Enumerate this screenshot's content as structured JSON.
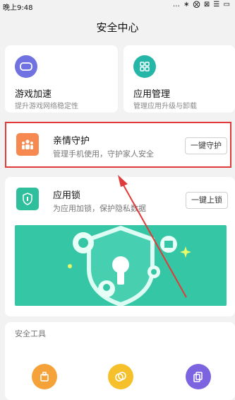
{
  "status_bar": {
    "time": "晚上9:48",
    "icons": "… ∗ ⨂ ⊠ ☰ ▭"
  },
  "page_title": "安全中心",
  "cards": {
    "game": {
      "title": "游戏加速",
      "subtitle": "提升游戏网络稳定性",
      "color": "#6f72e0"
    },
    "app_manage": {
      "title": "应用管理",
      "subtitle": "管理应用升级与卸载",
      "color": "#26b6a8"
    },
    "family": {
      "title": "亲情守护",
      "subtitle": "管理手机使用，守护家人安全",
      "button": "一键守护",
      "color": "#f5894f"
    },
    "app_lock": {
      "title": "应用锁",
      "subtitle": "为应用加锁，保护隐私数据",
      "button": "一键上锁",
      "color": "#2fbf9d"
    }
  },
  "tools": {
    "label": "安全工具"
  },
  "colors": {
    "accent_red": "#e03a3a",
    "banner_green": "#34c6a5"
  }
}
